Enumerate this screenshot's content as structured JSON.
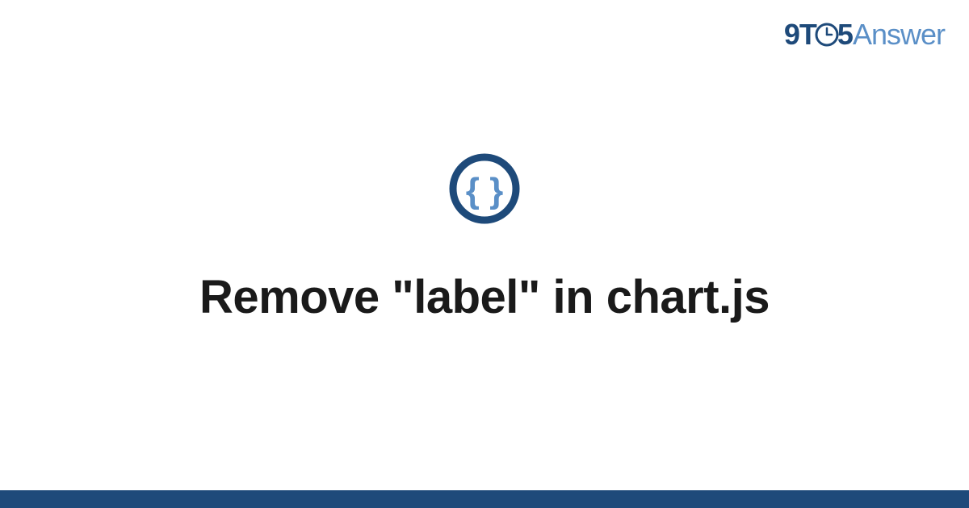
{
  "header": {
    "logo": {
      "part1": "9T",
      "part2": "5",
      "part3": "Answer"
    }
  },
  "main": {
    "title": "Remove \"label\" in chart.js"
  },
  "colors": {
    "primary": "#1e4a7a",
    "secondary": "#5a8fc7",
    "accent": "#4a7db8"
  }
}
